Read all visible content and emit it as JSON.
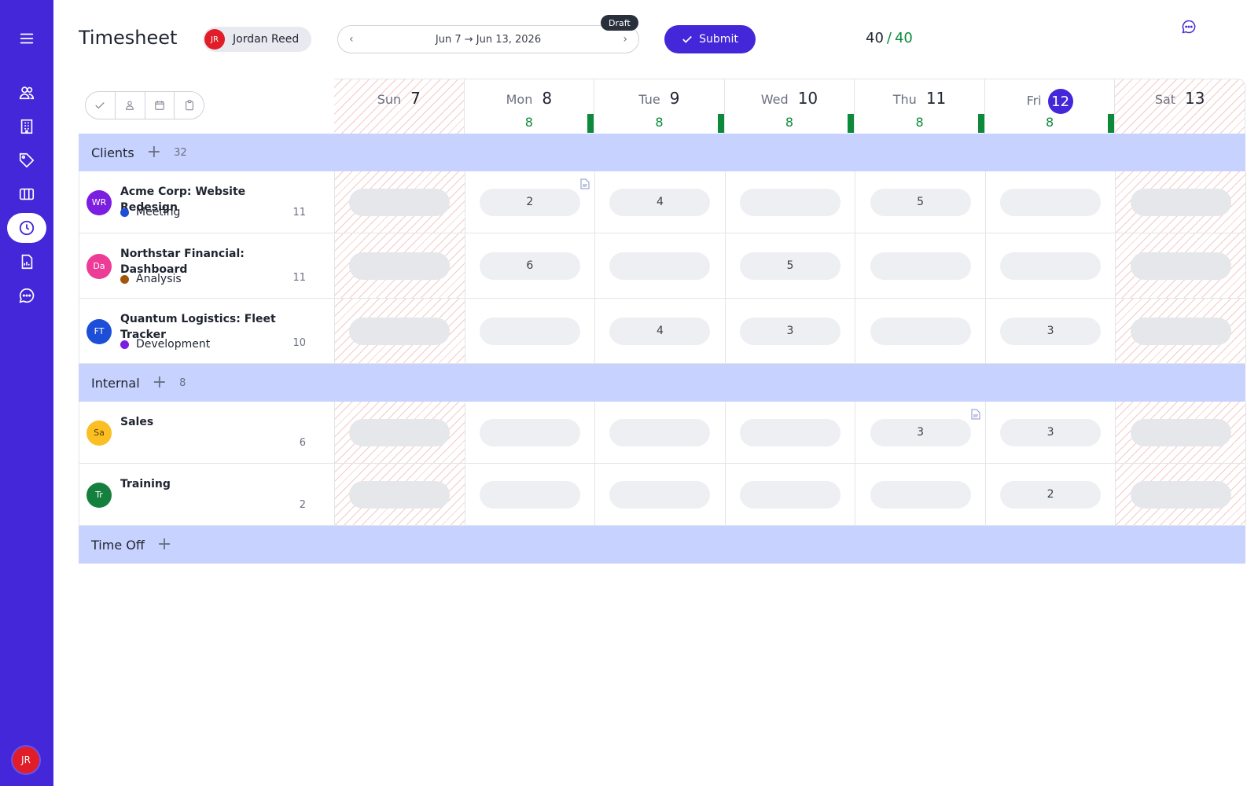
{
  "sidebar": {
    "items": [
      {
        "icon": "menu-icon"
      },
      {
        "icon": "users-icon"
      },
      {
        "icon": "building-icon"
      },
      {
        "icon": "tag-icon"
      },
      {
        "icon": "columns-icon"
      },
      {
        "icon": "clock-icon",
        "active": true
      },
      {
        "icon": "report-icon"
      },
      {
        "icon": "chat-icon"
      }
    ],
    "avatar_initials": "JR"
  },
  "header": {
    "title": "Timesheet",
    "user": {
      "initials": "JR",
      "name": "Jordan Reed"
    },
    "date_range": "Jun 7 → Jun 13, 2026",
    "status_badge": "Draft",
    "submit_label": "Submit",
    "hours_logged": "40",
    "hours_separator": "/",
    "hours_target": "40"
  },
  "colors": {
    "brand": "#4327d8",
    "group_band": "#c7d2fe",
    "hours_ok": "#0c8a3a",
    "weekend_hatch": "#f6c9c9"
  },
  "days": [
    {
      "name": "Sun",
      "num": "7",
      "hours": "",
      "weekend": true,
      "today": false
    },
    {
      "name": "Mon",
      "num": "8",
      "hours": "8",
      "weekend": false,
      "today": false
    },
    {
      "name": "Tue",
      "num": "9",
      "hours": "8",
      "weekend": false,
      "today": false
    },
    {
      "name": "Wed",
      "num": "10",
      "hours": "8",
      "weekend": false,
      "today": false
    },
    {
      "name": "Thu",
      "num": "11",
      "hours": "8",
      "weekend": false,
      "today": false
    },
    {
      "name": "Fri",
      "num": "12",
      "hours": "8",
      "weekend": false,
      "today": true
    },
    {
      "name": "Sat",
      "num": "13",
      "hours": "",
      "weekend": true,
      "today": false
    }
  ],
  "groups": [
    {
      "name": "Clients",
      "count": "32",
      "rows": [
        {
          "initials": "WR",
          "avatar_color": "#7c1ee0",
          "project": "Acme Corp: Website Redesign",
          "task": "Meeting",
          "task_color": "#1d4ed8",
          "total": "11",
          "lines": 1,
          "cells": [
            "",
            "2",
            "4",
            "",
            "5",
            "",
            ""
          ],
          "notes": [
            1
          ]
        },
        {
          "initials": "Da",
          "avatar_color": "#ec3c96",
          "project": "Northstar Financial: Dashboard",
          "task": "Analysis",
          "task_color": "#a1560a",
          "total": "11",
          "lines": 2,
          "cells": [
            "",
            "6",
            "",
            "5",
            "",
            "",
            ""
          ],
          "notes": []
        },
        {
          "initials": "FT",
          "avatar_color": "#1d4ed8",
          "project": "Quantum Logistics: Fleet Tracker",
          "task": "Development",
          "task_color": "#7c1ee0",
          "total": "10",
          "lines": 2,
          "cells": [
            "",
            "",
            "4",
            "3",
            "",
            "3",
            ""
          ],
          "notes": []
        }
      ]
    },
    {
      "name": "Internal",
      "count": "8",
      "rows": [
        {
          "initials": "Sa",
          "avatar_color": "#fbbf24",
          "avatar_text": "#5a3d00",
          "project": "Sales",
          "task": "",
          "total": "6",
          "lines": 1,
          "cells": [
            "",
            "",
            "",
            "",
            "3",
            "3",
            ""
          ],
          "notes": [
            4
          ]
        },
        {
          "initials": "Tr",
          "avatar_color": "#15803d",
          "project": "Training",
          "task": "",
          "total": "2",
          "lines": 1,
          "cells": [
            "",
            "",
            "",
            "",
            "",
            "2",
            ""
          ],
          "notes": []
        }
      ]
    },
    {
      "name": "Time Off",
      "count": "",
      "rows": []
    }
  ]
}
